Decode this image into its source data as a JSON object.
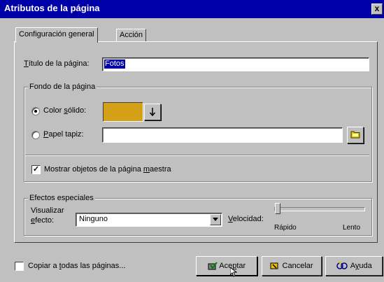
{
  "window": {
    "title": "Atributos de la página",
    "close_glyph": "x"
  },
  "tabs": [
    {
      "label": "Configuración general"
    },
    {
      "label": "Acción"
    }
  ],
  "page_title": {
    "label_first": "T",
    "label_rest": "ítulo de la página:",
    "value": "Fotos"
  },
  "background_group": {
    "legend": "Fondo de la página",
    "solid_color": {
      "label_a": "Color ",
      "label_b": "s",
      "label_c": "ólido:",
      "swatch_color": "#d4a017",
      "selected": true
    },
    "wallpaper": {
      "label_first": "P",
      "label_rest": "apel tapiz:",
      "value": "",
      "selected": false
    },
    "show_master": {
      "label_a": "Mostrar objetos de la página ",
      "label_b": "m",
      "label_c": "aestra",
      "checked": true
    }
  },
  "effects_group": {
    "legend": "Efectos especiales",
    "visualize_line1": "Visualizar",
    "visualize_line2_first": "e",
    "visualize_line2_rest": "fecto:",
    "effect_value": "Ninguno",
    "speed_label_first": "V",
    "speed_label_rest": "elocidad:",
    "speed_fast": "Rápido",
    "speed_slow": "Lento",
    "speed_level": 0
  },
  "footer": {
    "copy_all_a": "Copiar a ",
    "copy_all_b": "t",
    "copy_all_c": "odas las páginas...",
    "copy_all_checked": false,
    "accept_a": "Ace",
    "accept_b": "p",
    "accept_c": "tar",
    "cancel": "Cancelar",
    "help_a": "A",
    "help_b": "y",
    "help_c": "uda"
  },
  "colors": {
    "titlebar": "#0000a8",
    "face": "#c0c0c0",
    "selection": "#0000a8",
    "folder": "#e8c000",
    "check_green": "#008000"
  }
}
